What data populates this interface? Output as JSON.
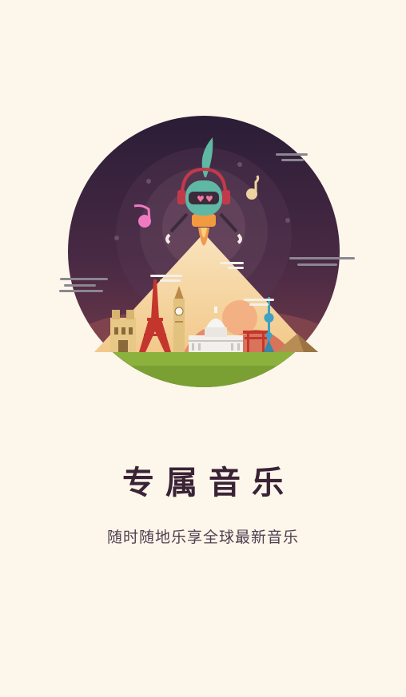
{
  "onboarding": {
    "title": "专属音乐",
    "subtitle": "随时随地乐享全球最新音乐"
  },
  "colors": {
    "background": "#fdf6ea",
    "title": "#3a2336",
    "subtitle": "#4f4050",
    "sky_top": "#2d1e38",
    "sky_bottom": "#6a3a4c",
    "ground": "#8ab23c"
  }
}
